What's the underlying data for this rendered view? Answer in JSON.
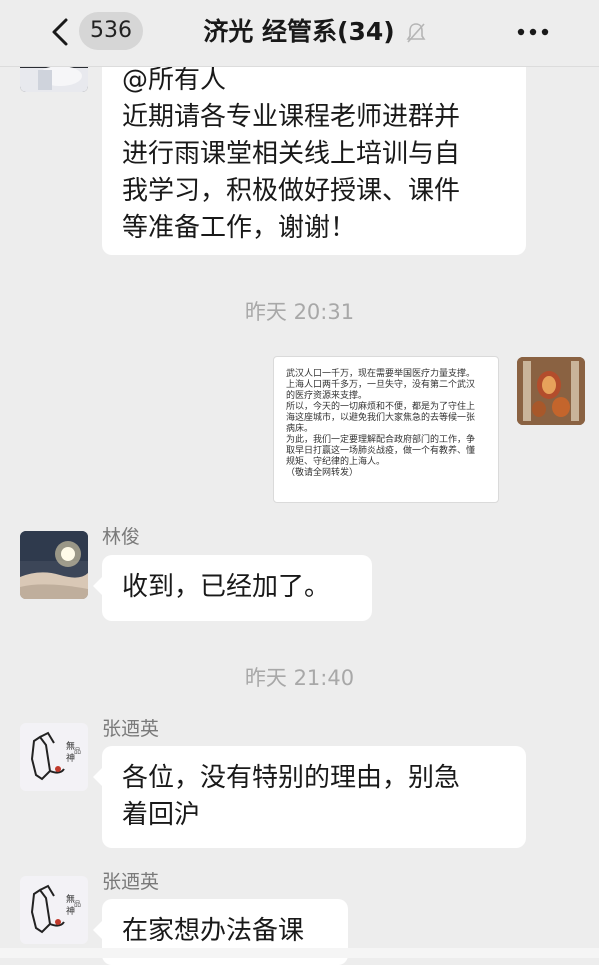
{
  "header": {
    "unread_count": "536",
    "title": "济光 经管系(34)"
  },
  "messages": {
    "m1": {
      "lines": [
        "@所有人",
        "近期请各专业课程老师进群并",
        "进行雨课堂相关线上培训与自",
        "我学习，积极做好授课、课件",
        "等准备工作，谢谢！"
      ]
    },
    "ts1": "昨天 20:31",
    "image_message": {
      "lines": [
        "武汉人口一千万，现在需要举国医疗力量支撑。",
        "上海人口两千多万，一旦失守，没有第二个武汉",
        "的医疗资源来支撑。",
        "所以，今天的一切麻烦和不便，都是为了守住上",
        "海这座城市，以避免我们大家焦急的去等候一张",
        "病床。",
        "为此，我们一定要理解配合政府部门的工作，争",
        "取早日打赢这一场肺炎战疫，做一个有教养、懂",
        "规矩、守纪律的上海人。",
        "（敬请全网转发）"
      ]
    },
    "m2": {
      "sender": "林俊",
      "text": "收到，已经加了。"
    },
    "ts2": "昨天 21:40",
    "m3": {
      "sender": "张迺英",
      "lines": [
        "各位，没有特别的理由，别急",
        "着回沪"
      ]
    },
    "m4": {
      "sender": "张迺英",
      "text": "在家想办法备课"
    }
  },
  "colors": {
    "background": "#ededed",
    "bubble": "#ffffff",
    "timestamp": "#a8a8a8",
    "sender_name": "#7a7a7a"
  }
}
